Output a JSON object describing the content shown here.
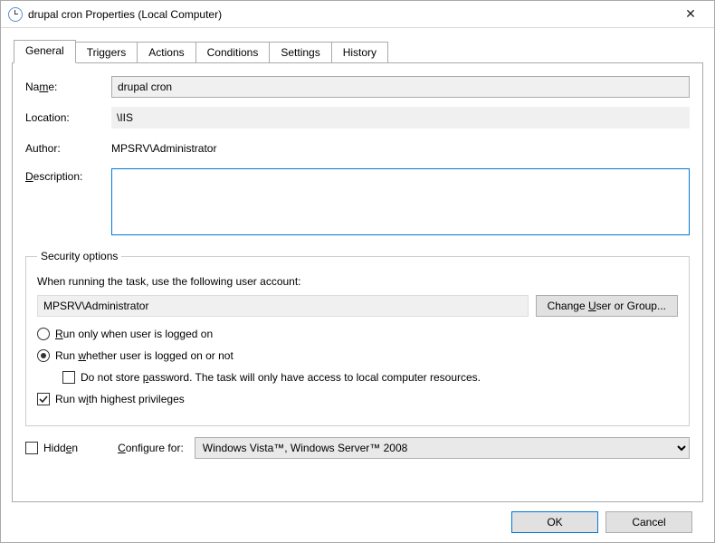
{
  "window": {
    "title": "drupal cron Properties (Local Computer)",
    "icon": "clock-icon"
  },
  "tabs": [
    "General",
    "Triggers",
    "Actions",
    "Conditions",
    "Settings",
    "History"
  ],
  "active_tab_index": 0,
  "general": {
    "name_label": "Name:",
    "name_value": "drupal cron",
    "location_label": "Location:",
    "location_value": "\\IIS",
    "author_label": "Author:",
    "author_value": "MPSRV\\Administrator",
    "description_label": "Description:",
    "description_value": ""
  },
  "security": {
    "legend": "Security options",
    "intro": "When running the task, use the following user account:",
    "account": "MPSRV\\Administrator",
    "change_user_label": "Change User or Group...",
    "run_logged_on_label": "Run only when user is logged on",
    "run_whether_label": "Run whether user is logged on or not",
    "run_mode_selected": "whether",
    "no_store_pw_label": "Do not store password.  The task will only have access to local computer resources.",
    "no_store_pw_checked": false,
    "highest_priv_label": "Run with highest privileges",
    "highest_priv_checked": true
  },
  "bottom": {
    "hidden_label": "Hidden",
    "hidden_checked": false,
    "configure_label": "Configure for:",
    "configure_value": "Windows Vista™, Windows Server™ 2008"
  },
  "buttons": {
    "ok": "OK",
    "cancel": "Cancel"
  }
}
